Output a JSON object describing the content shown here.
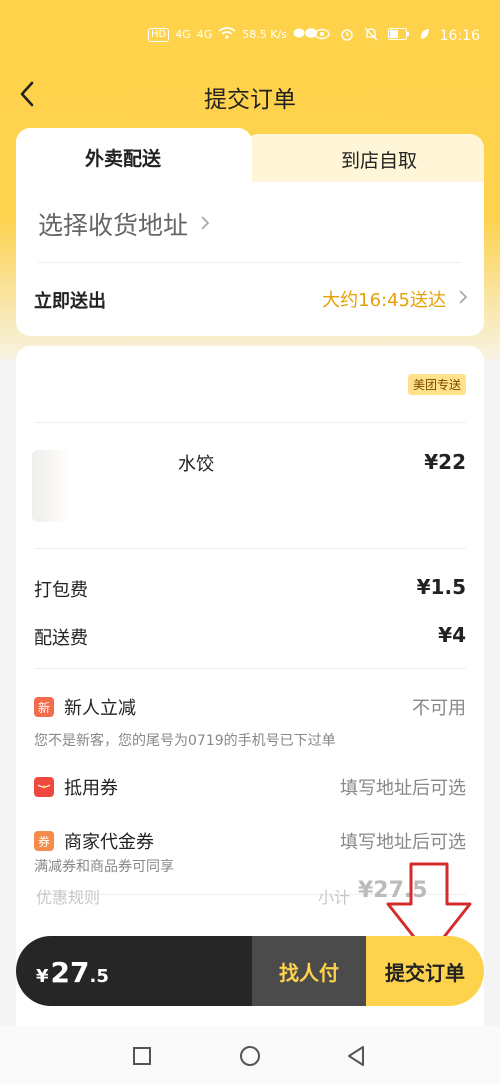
{
  "status_bar": {
    "network_badge": "HD",
    "signal1": "4G",
    "signal2": "4G",
    "speed": "58.5 K/s",
    "time": "16:16"
  },
  "nav": {
    "title": "提交订单"
  },
  "tabs": [
    {
      "label": "外卖配送",
      "active": true
    },
    {
      "label": "到店自取",
      "active": false
    }
  ],
  "address": {
    "placeholder": "选择收货地址",
    "deliver_label": "立即送出",
    "deliver_time": "大约16:45送达"
  },
  "order": {
    "delivery_tag": "美团专送",
    "item": {
      "name": "水饺",
      "price": "¥22"
    },
    "fees": [
      {
        "label": "打包费",
        "value": "¥1.5"
      },
      {
        "label": "配送费",
        "value": "¥4"
      }
    ],
    "promotions": [
      {
        "icon": "新",
        "label": "新人立减",
        "status": "不可用",
        "note": "您不是新客，您的尾号为0719的手机号已下过单",
        "color": "#f26b4a"
      },
      {
        "icon": "",
        "label": "抵用券",
        "status": "填写地址后可选",
        "note": "",
        "color": "#f0483e"
      },
      {
        "icon": "券",
        "label": "商家代金券",
        "status": "填写地址后可选",
        "note": "满减券和商品券可同享",
        "color": "#f58b4a"
      }
    ],
    "rules_label": "优惠规则",
    "subtotal_label": "小计",
    "subtotal_value": "¥27.5"
  },
  "bottom": {
    "currency": "¥",
    "total_int": "27",
    "total_dec": ".5",
    "find_pay": "找人付",
    "submit": "提交订单"
  },
  "colors": {
    "brand_yellow": "#fdd24d",
    "accent_orange": "#e6a008",
    "dark": "#262626",
    "annotation_arrow": "#d42b2b"
  }
}
